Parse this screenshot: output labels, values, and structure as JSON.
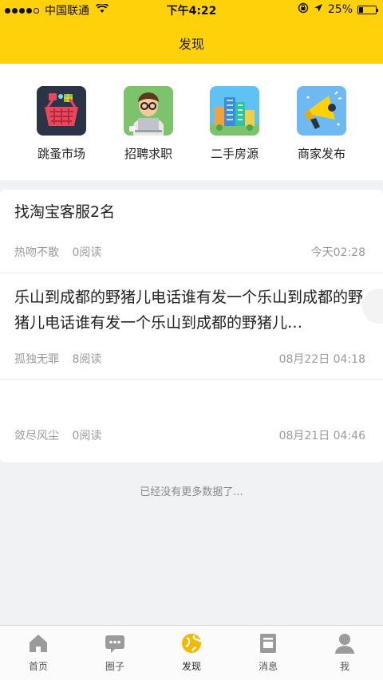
{
  "status_bar": {
    "carrier": "中国联通",
    "time": "下午4:22",
    "battery": "25%",
    "battery_level": 0.25
  },
  "header": {
    "title": "发现"
  },
  "quick_entries": [
    {
      "label": "跳蚤市场",
      "icon": "shopping-basket-icon"
    },
    {
      "label": "招聘求职",
      "icon": "job-seeker-icon"
    },
    {
      "label": "二手房源",
      "icon": "buildings-icon"
    },
    {
      "label": "商家发布",
      "icon": "megaphone-icon"
    }
  ],
  "posts": [
    {
      "title": "找淘宝客服2名",
      "author": "热吻不散",
      "reads": "0阅读",
      "date": "今天02:28"
    },
    {
      "title": "乐山到成都的野猪儿电话谁有发一个乐山到成都的野猪儿电话谁有发一个乐山到成都的野猪儿…",
      "author": "孤独无罪",
      "reads": "8阅读",
      "date": "08月22日 04:18"
    },
    {
      "title": "",
      "author": "敛尽风尘",
      "reads": "0阅读",
      "date": "08月21日 04:46"
    }
  ],
  "no_more": "已经没有更多数据了...",
  "tabs": [
    {
      "label": "首页",
      "icon": "home-icon"
    },
    {
      "label": "圈子",
      "icon": "chat-bubble-icon"
    },
    {
      "label": "发现",
      "icon": "globe-icon",
      "active": true
    },
    {
      "label": "消息",
      "icon": "message-icon"
    },
    {
      "label": "我",
      "icon": "person-icon"
    }
  ],
  "colors": {
    "brand_yellow": "#ffd10a",
    "active_tab": "#f5b800"
  }
}
